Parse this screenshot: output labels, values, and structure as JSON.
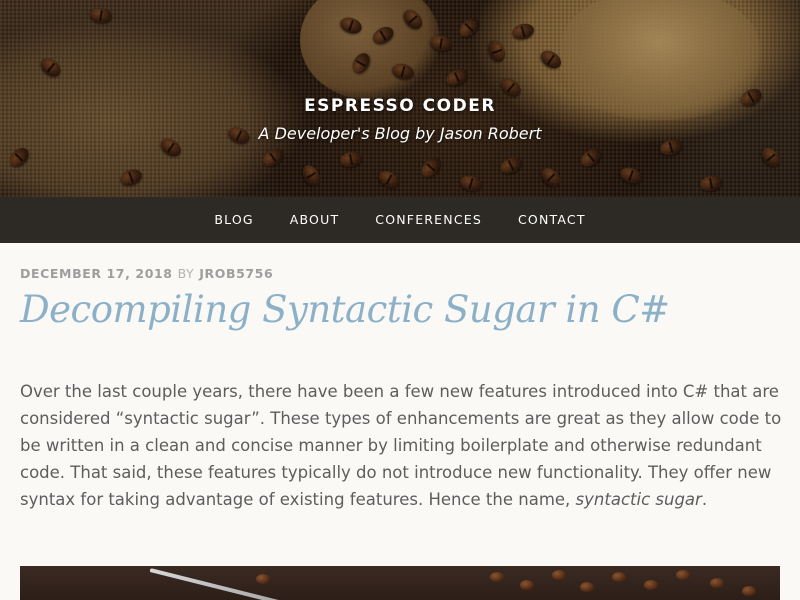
{
  "site": {
    "title": "ESPRESSO CODER",
    "tagline": "A Developer's Blog by Jason Robert"
  },
  "nav": {
    "items": [
      {
        "label": "BLOG"
      },
      {
        "label": "ABOUT"
      },
      {
        "label": "CONFERENCES"
      },
      {
        "label": "CONTACT"
      }
    ]
  },
  "post": {
    "date": "DECEMBER 17, 2018",
    "by": "BY",
    "author": "JROB5756",
    "title": "Decompiling Syntactic Sugar in C#",
    "body_main": "Over the last couple years, there have been a few new features introduced into C# that are considered “syntactic sugar”.  These types of enhancements are great as they allow code to be written in a clean and concise manner by limiting boilerplate and otherwise redundant code.  That said, these features typically do not introduce new functionality.  They offer new syntax for taking advantage of existing features. Hence the name, ",
    "body_emphasis": "syntactic sugar",
    "body_end": "."
  },
  "colors": {
    "nav_background": "#2d2a26",
    "title_color": "#8bb0c8",
    "body_text": "#5d5d5d",
    "meta_text": "#9e9e9e",
    "page_background": "#fbf9f6"
  }
}
